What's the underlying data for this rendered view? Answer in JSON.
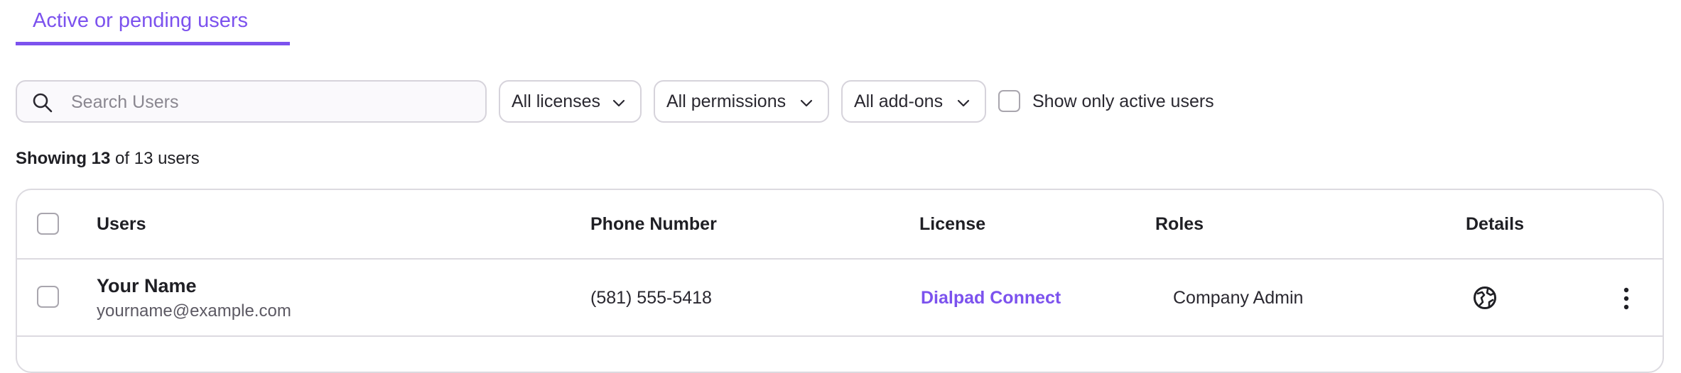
{
  "tabs": {
    "active_label": "Active or pending users"
  },
  "filters": {
    "search_placeholder": "Search Users",
    "search_value": "",
    "licenses": "All licenses",
    "permissions": "All permissions",
    "addons": "All add-ons",
    "active_only_label": "Show only active users",
    "active_only_checked": false
  },
  "summary": {
    "prefix": "Showing",
    "shown": "13",
    "rest": "of 13 users"
  },
  "table": {
    "columns": {
      "users": "Users",
      "phone": "Phone Number",
      "license": "License",
      "roles": "Roles",
      "details": "Details"
    },
    "rows": [
      {
        "name": "Your Name",
        "email": "yourname@example.com",
        "phone": "(581) 555-5418",
        "license": "Dialpad Connect",
        "role": "Company Admin",
        "details_icon": "globe-icon",
        "menu_icon": "more-vertical-icon"
      }
    ]
  },
  "colors": {
    "accent": "#7c52ee",
    "border": "#dcdae0",
    "text": "#1f1f24",
    "muted_text": "#5c5963"
  }
}
